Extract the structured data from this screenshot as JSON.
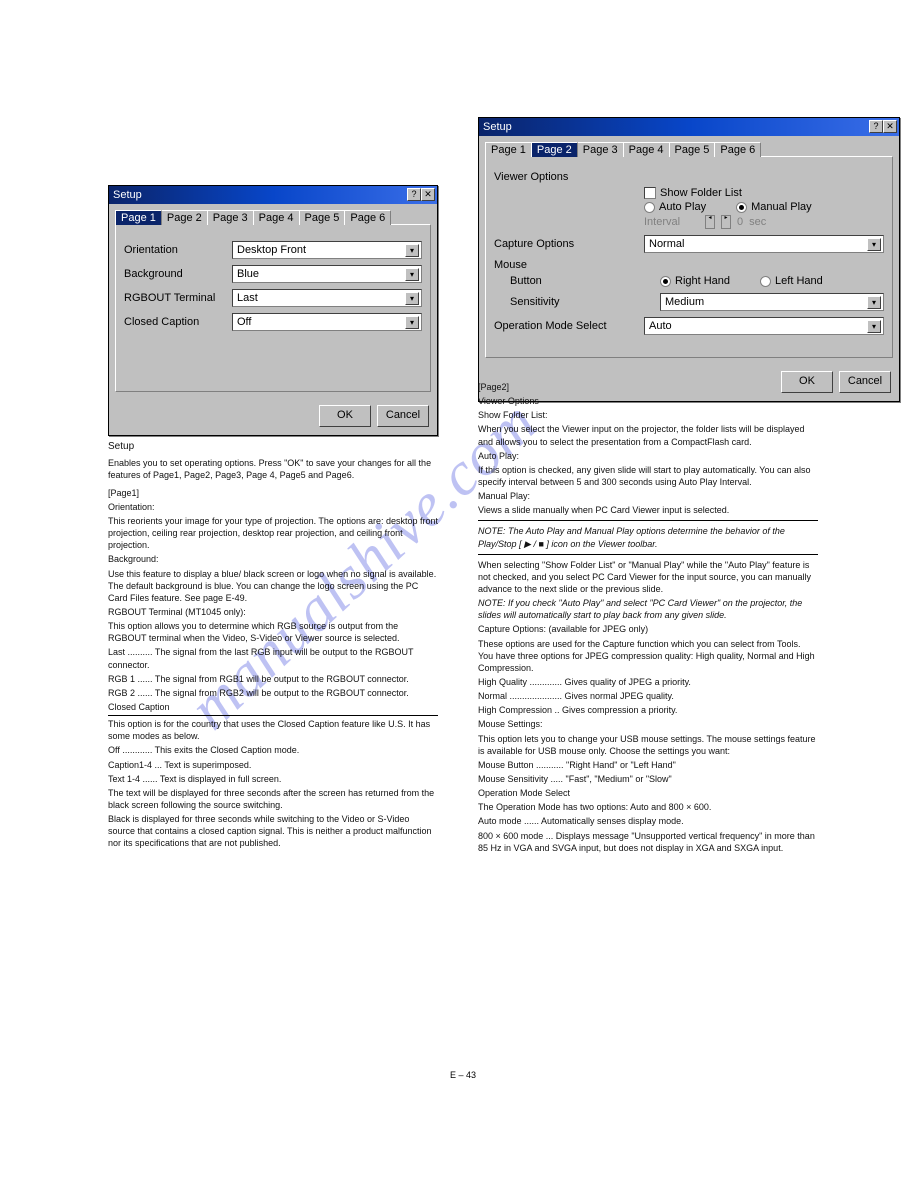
{
  "watermark": "manualshive.com",
  "page_number": "E – 43",
  "dialog1": {
    "title": "Setup",
    "tabs": [
      "Page 1",
      "Page 2",
      "Page 3",
      "Page 4",
      "Page 5",
      "Page 6"
    ],
    "active_tab": 0,
    "fields": {
      "orientation_label": "Orientation",
      "orientation_value": "Desktop Front",
      "background_label": "Background",
      "background_value": "Blue",
      "rgbout_label": "RGBOUT Terminal",
      "rgbout_value": "Last",
      "caption_label": "Closed Caption",
      "caption_value": "Off"
    },
    "ok": "OK",
    "cancel": "Cancel"
  },
  "dialog2": {
    "title": "Setup",
    "tabs": [
      "Page 1",
      "Page 2",
      "Page 3",
      "Page 4",
      "Page 5",
      "Page 6"
    ],
    "active_tab": 1,
    "viewer_options_label": "Viewer Options",
    "show_folder_label": "Show Folder List",
    "auto_play_label": "Auto Play",
    "manual_play_label": "Manual Play",
    "interval_label": "Interval",
    "interval_value": "0",
    "interval_unit": "sec",
    "capture_options_label": "Capture Options",
    "capture_value": "Normal",
    "mouse_label": "Mouse",
    "button_label": "Button",
    "right_hand_label": "Right Hand",
    "left_hand_label": "Left Hand",
    "sensitivity_label": "Sensitivity",
    "sensitivity_value": "Medium",
    "opmode_label": "Operation Mode Select",
    "opmode_value": "Auto",
    "ok": "OK",
    "cancel": "Cancel"
  },
  "left_text": {
    "setup_heading": "Setup",
    "setup_desc": "Enables you to set operating options.\nPress \"OK\" to save your changes for all the features of Page1, Page2, Page3, Page 4, Page5 and Page6.",
    "page1_heading": "[Page1]",
    "orientation_h": "Orientation:",
    "orientation_p": "This reorients your image for your type of projection.\nThe options are: desktop front projection, ceiling rear projection, desktop rear projection, and ceiling front projection.",
    "background_h": "Background:",
    "background_p": "Use this feature to display a blue/ black screen or logo when no signal is available. The default background is blue. You can change the logo screen using the PC Card Files feature. See page E-49.",
    "rgbout_h": "RGBOUT Terminal (MT1045 only):",
    "rgbout_p": "This option allows you to determine which RGB source is output from the RGBOUT terminal when the Video, S-Video or Viewer source is selected.",
    "rgbout_last": "Last .......... The signal from the last RGB input will be output to the RGBOUT connector.",
    "rgbout_rgb1": "RGB 1 ...... The signal from RGB1 will be output to the RGBOUT connector.",
    "rgbout_rgb2": "RGB 2 ...... The signal from RGB2 will be output to the RGBOUT connector.",
    "caption_h": "Closed Caption",
    "caption_p1": "This option is for the country that uses the Closed Caption feature like U.S. It has some modes as below.",
    "caption_off": "Off ............ This exits the Closed Caption mode.",
    "caption_cap": "Caption1-4 ... Text is superimposed.",
    "caption_txt": "Text 1-4 ...... Text is displayed in full screen.",
    "caption_p2": "The text will be displayed for three seconds after the screen has returned from the black screen following the source switching.",
    "caption_p3": "Black is displayed for three seconds while switching to the Video or S-Video source that contains a closed caption signal. This is neither a product malfunction nor its specifications that are not published."
  },
  "right_text": {
    "page2_heading": "[Page2]",
    "viewer_h": "Viewer Options",
    "show_folder_h": "Show Folder List:",
    "show_folder_p": "When you select the Viewer input on the projector, the folder lists will be displayed and allows you to select the presentation from a CompactFlash card.",
    "auto_h": "Auto Play:",
    "auto_p": "If this option is checked, any given slide will start to play automatically. You can also specify interval between 5 and 300 seconds using Auto Play Interval.",
    "manual_h": "Manual Play:",
    "manual_p": "Views a slide manually when PC Card Viewer input is selected.",
    "note": "NOTE: The Auto Play and Manual Play options determine the behavior of the Play/Stop [ ▶ / ■ ] icon on the Viewer toolbar.",
    "nosel_p1": "When selecting \"Show Folder List\" or \"Manual Play\" while the \"Auto Play\" feature is not checked, and you select PC Card Viewer for the input source, you can manually advance to the next slide or the previous slide.",
    "note2": "NOTE: If you check \"Auto Play\" and select \"PC Card Viewer\" on the projector, the slides will automatically start to play back from any given slide.",
    "capture_h": "Capture Options: (available for JPEG only)",
    "capture_p": "These options are used for the Capture function which you can select from Tools. You have three options for JPEG compression quality: High quality, Normal and High Compression.",
    "capture_hq": "High Quality ............. Gives quality of JPEG a priority.",
    "capture_n": "Normal ..................... Gives normal JPEG quality.",
    "capture_hc": "High Compression .. Gives compression a priority.",
    "mouse_h": "Mouse Settings:",
    "mouse_p": "This option lets you to change your USB mouse settings. The mouse settings feature is available for USB mouse only. Choose the settings you want:",
    "mouse_btn": "Mouse Button ........... \"Right Hand\" or \"Left Hand\"",
    "mouse_sens": "Mouse Sensitivity ..... \"Fast\", \"Medium\" or \"Slow\"",
    "opmode_h": "Operation Mode Select",
    "opmode_p": "The Operation Mode has two options: Auto and 800 × 600.",
    "opmode_auto": "Auto mode ...... Automatically senses display mode.",
    "opmode_800": "800 × 600 mode ... Displays message \"Unsupported vertical frequency\" in more than 85 Hz in VGA and SVGA input, but does not display in XGA and SXGA input."
  }
}
